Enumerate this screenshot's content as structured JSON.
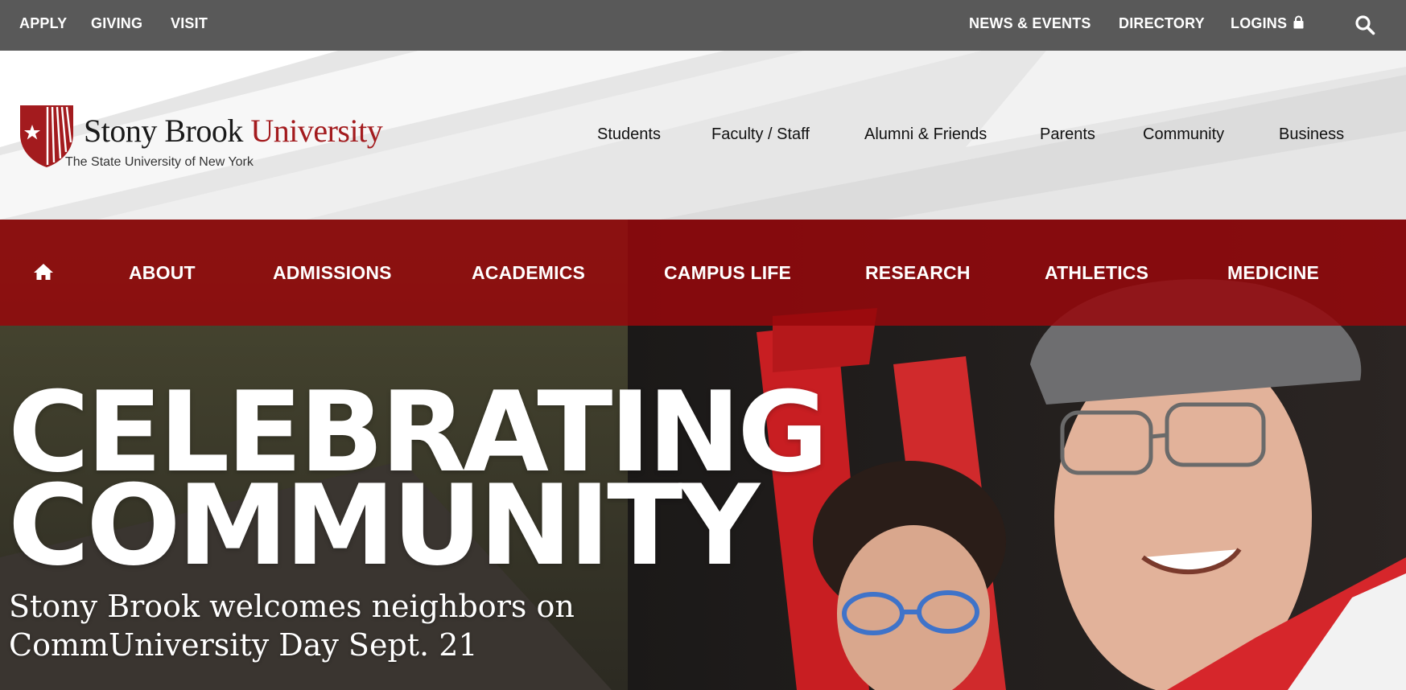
{
  "utility_nav": {
    "left": [
      "APPLY",
      "GIVING",
      "VISIT"
    ],
    "right": [
      "NEWS & EVENTS",
      "DIRECTORY",
      "LOGINS"
    ]
  },
  "logo": {
    "name_main": "Stony Brook ",
    "name_accent": "University",
    "subtitle": "The State University of New York"
  },
  "audience_nav": [
    "Students",
    "Faculty / Staff",
    "Alumni & Friends",
    "Parents",
    "Community",
    "Business"
  ],
  "main_nav": [
    "ABOUT",
    "ADMISSIONS",
    "ACADEMICS",
    "CAMPUS LIFE",
    "RESEARCH",
    "ATHLETICS",
    "MEDICINE"
  ],
  "hero": {
    "headline_line1": "CELEBRATING",
    "headline_line2": "COMMUNITY",
    "subline": "Stony Brook welcomes neighbors on CommUniversity Day Sept. 21"
  },
  "colors": {
    "utility_bar": "#595959",
    "brand_red": "#a31b1e",
    "nav_red": "#96080c",
    "header_bg": "#ebebeb"
  },
  "icons": [
    "lock-icon",
    "search-icon",
    "home-icon",
    "shield-logo-icon"
  ]
}
